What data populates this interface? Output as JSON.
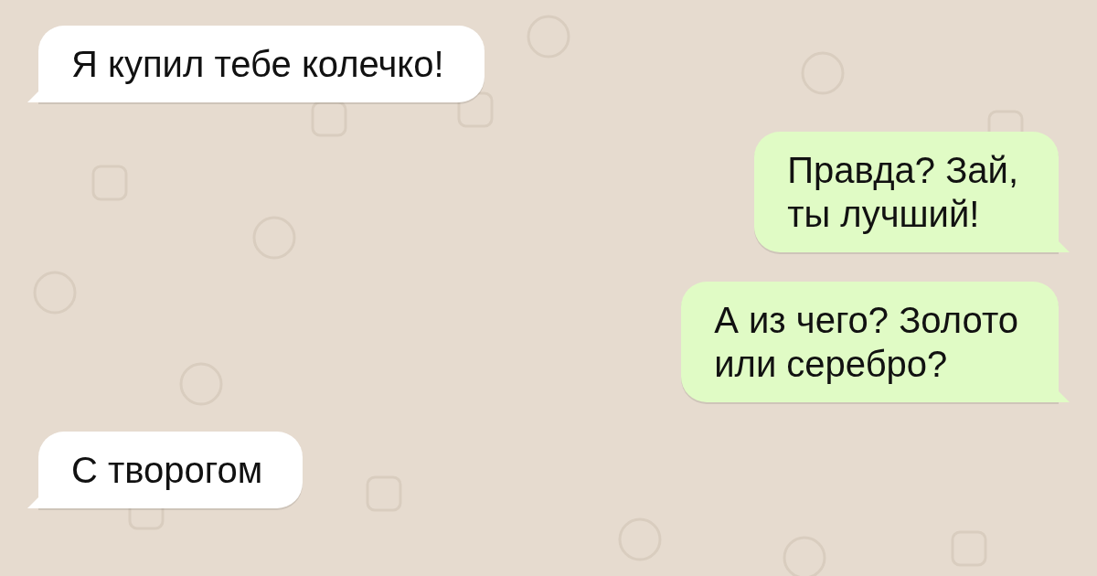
{
  "messages": [
    {
      "text": "Я купил тебе колечко!",
      "kind": "incoming"
    },
    {
      "text": "Правда? Зай,\nты лучший!",
      "kind": "outgoing"
    },
    {
      "text": "А из чего? Золото\nили серебро?",
      "kind": "outgoing"
    },
    {
      "text": "С творогом",
      "kind": "incoming"
    }
  ]
}
